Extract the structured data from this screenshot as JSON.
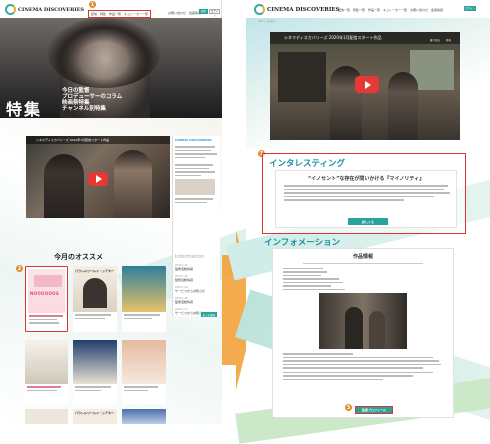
{
  "left": {
    "logo": "CINEMA DISCOVERIES",
    "nav": [
      "配信",
      "特集",
      "作品一覧",
      "キュレーター一覧",
      "お問い合わせ",
      "会員情報"
    ],
    "search_label": "検索",
    "login_label": "ログイン",
    "hero_title": "特集",
    "hero_lines": [
      "今日の監督",
      "プロデューサーのコラム",
      "映画祭特集",
      "チャンネル別特集"
    ],
    "video_title": "シネマディスカバリーズ 2020年1月配信スタート作品",
    "sidebar_title": "CINEMA DISCOVERIES",
    "information_label": "Information",
    "news": [
      {
        "date": "2020.1.31",
        "text": "監督活動情報"
      },
      {
        "date": "2020.1.30",
        "text": "監督活動情報"
      },
      {
        "date": "2020.1.29",
        "text": "サービスからお知らせ"
      },
      {
        "date": "2020.1.28",
        "text": "監督活動情報"
      },
      {
        "date": "2020.1.27",
        "text": "サービスからお知らせ"
      }
    ],
    "more_label": "もっと見る",
    "recommend_title": "今月のオススメ",
    "poster1_text": "NOOOOOOS",
    "poster2_text": "パラレルワールド・シアター",
    "poster6_text": "パラレルワールド・シアター"
  },
  "right": {
    "logo": "CINEMA DISCOVERIES",
    "nav": [
      "配信一覧",
      "特集一覧",
      "作品一覧",
      "キュレーター一覧",
      "お問い合わせ",
      "会員情報"
    ],
    "login_label": "ログイン",
    "breadcrumb": "TOP ＞ 作品名",
    "video_title": "シネマディスカバリーズ 2020年1月配信スタート作品",
    "video_later": "後で見る",
    "video_share": "共有",
    "section1_title": "インタレスティング",
    "section1_heading": "“イノセント”な存在が問いかける『マイノリティ』",
    "section1_button": "詳しくる",
    "section2_title": "インフォメーション",
    "info_heading": "作品情報",
    "info_button": "監督プロフィール",
    "markers": [
      "1",
      "2",
      "3",
      "3"
    ]
  },
  "colors": {
    "accent": "#2aa39b",
    "title": "#1b8e9f",
    "highlight": "#d33333",
    "marker": "#e08b2a",
    "arrow": "#f2a23a"
  }
}
